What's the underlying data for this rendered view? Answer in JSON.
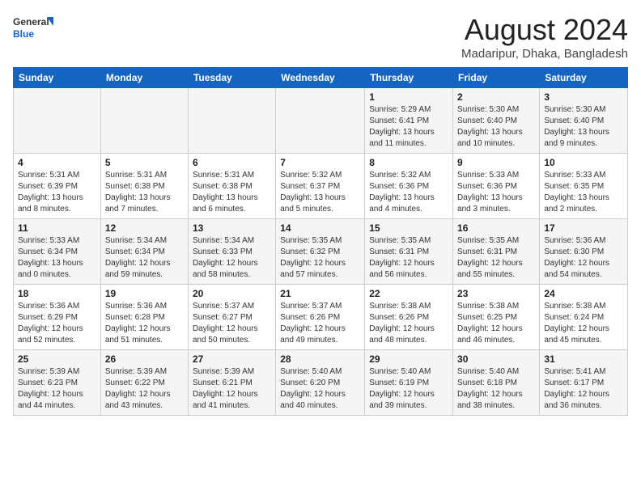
{
  "logo": {
    "line1": "General",
    "line2": "Blue"
  },
  "title": "August 2024",
  "subtitle": "Madaripur, Dhaka, Bangladesh",
  "days_of_week": [
    "Sunday",
    "Monday",
    "Tuesday",
    "Wednesday",
    "Thursday",
    "Friday",
    "Saturday"
  ],
  "weeks": [
    [
      {
        "day": "",
        "info": ""
      },
      {
        "day": "",
        "info": ""
      },
      {
        "day": "",
        "info": ""
      },
      {
        "day": "",
        "info": ""
      },
      {
        "day": "1",
        "info": "Sunrise: 5:29 AM\nSunset: 6:41 PM\nDaylight: 13 hours\nand 11 minutes."
      },
      {
        "day": "2",
        "info": "Sunrise: 5:30 AM\nSunset: 6:40 PM\nDaylight: 13 hours\nand 10 minutes."
      },
      {
        "day": "3",
        "info": "Sunrise: 5:30 AM\nSunset: 6:40 PM\nDaylight: 13 hours\nand 9 minutes."
      }
    ],
    [
      {
        "day": "4",
        "info": "Sunrise: 5:31 AM\nSunset: 6:39 PM\nDaylight: 13 hours\nand 8 minutes."
      },
      {
        "day": "5",
        "info": "Sunrise: 5:31 AM\nSunset: 6:38 PM\nDaylight: 13 hours\nand 7 minutes."
      },
      {
        "day": "6",
        "info": "Sunrise: 5:31 AM\nSunset: 6:38 PM\nDaylight: 13 hours\nand 6 minutes."
      },
      {
        "day": "7",
        "info": "Sunrise: 5:32 AM\nSunset: 6:37 PM\nDaylight: 13 hours\nand 5 minutes."
      },
      {
        "day": "8",
        "info": "Sunrise: 5:32 AM\nSunset: 6:36 PM\nDaylight: 13 hours\nand 4 minutes."
      },
      {
        "day": "9",
        "info": "Sunrise: 5:33 AM\nSunset: 6:36 PM\nDaylight: 13 hours\nand 3 minutes."
      },
      {
        "day": "10",
        "info": "Sunrise: 5:33 AM\nSunset: 6:35 PM\nDaylight: 13 hours\nand 2 minutes."
      }
    ],
    [
      {
        "day": "11",
        "info": "Sunrise: 5:33 AM\nSunset: 6:34 PM\nDaylight: 13 hours\nand 0 minutes."
      },
      {
        "day": "12",
        "info": "Sunrise: 5:34 AM\nSunset: 6:34 PM\nDaylight: 12 hours\nand 59 minutes."
      },
      {
        "day": "13",
        "info": "Sunrise: 5:34 AM\nSunset: 6:33 PM\nDaylight: 12 hours\nand 58 minutes."
      },
      {
        "day": "14",
        "info": "Sunrise: 5:35 AM\nSunset: 6:32 PM\nDaylight: 12 hours\nand 57 minutes."
      },
      {
        "day": "15",
        "info": "Sunrise: 5:35 AM\nSunset: 6:31 PM\nDaylight: 12 hours\nand 56 minutes."
      },
      {
        "day": "16",
        "info": "Sunrise: 5:35 AM\nSunset: 6:31 PM\nDaylight: 12 hours\nand 55 minutes."
      },
      {
        "day": "17",
        "info": "Sunrise: 5:36 AM\nSunset: 6:30 PM\nDaylight: 12 hours\nand 54 minutes."
      }
    ],
    [
      {
        "day": "18",
        "info": "Sunrise: 5:36 AM\nSunset: 6:29 PM\nDaylight: 12 hours\nand 52 minutes."
      },
      {
        "day": "19",
        "info": "Sunrise: 5:36 AM\nSunset: 6:28 PM\nDaylight: 12 hours\nand 51 minutes."
      },
      {
        "day": "20",
        "info": "Sunrise: 5:37 AM\nSunset: 6:27 PM\nDaylight: 12 hours\nand 50 minutes."
      },
      {
        "day": "21",
        "info": "Sunrise: 5:37 AM\nSunset: 6:26 PM\nDaylight: 12 hours\nand 49 minutes."
      },
      {
        "day": "22",
        "info": "Sunrise: 5:38 AM\nSunset: 6:26 PM\nDaylight: 12 hours\nand 48 minutes."
      },
      {
        "day": "23",
        "info": "Sunrise: 5:38 AM\nSunset: 6:25 PM\nDaylight: 12 hours\nand 46 minutes."
      },
      {
        "day": "24",
        "info": "Sunrise: 5:38 AM\nSunset: 6:24 PM\nDaylight: 12 hours\nand 45 minutes."
      }
    ],
    [
      {
        "day": "25",
        "info": "Sunrise: 5:39 AM\nSunset: 6:23 PM\nDaylight: 12 hours\nand 44 minutes."
      },
      {
        "day": "26",
        "info": "Sunrise: 5:39 AM\nSunset: 6:22 PM\nDaylight: 12 hours\nand 43 minutes."
      },
      {
        "day": "27",
        "info": "Sunrise: 5:39 AM\nSunset: 6:21 PM\nDaylight: 12 hours\nand 41 minutes."
      },
      {
        "day": "28",
        "info": "Sunrise: 5:40 AM\nSunset: 6:20 PM\nDaylight: 12 hours\nand 40 minutes."
      },
      {
        "day": "29",
        "info": "Sunrise: 5:40 AM\nSunset: 6:19 PM\nDaylight: 12 hours\nand 39 minutes."
      },
      {
        "day": "30",
        "info": "Sunrise: 5:40 AM\nSunset: 6:18 PM\nDaylight: 12 hours\nand 38 minutes."
      },
      {
        "day": "31",
        "info": "Sunrise: 5:41 AM\nSunset: 6:17 PM\nDaylight: 12 hours\nand 36 minutes."
      }
    ]
  ]
}
